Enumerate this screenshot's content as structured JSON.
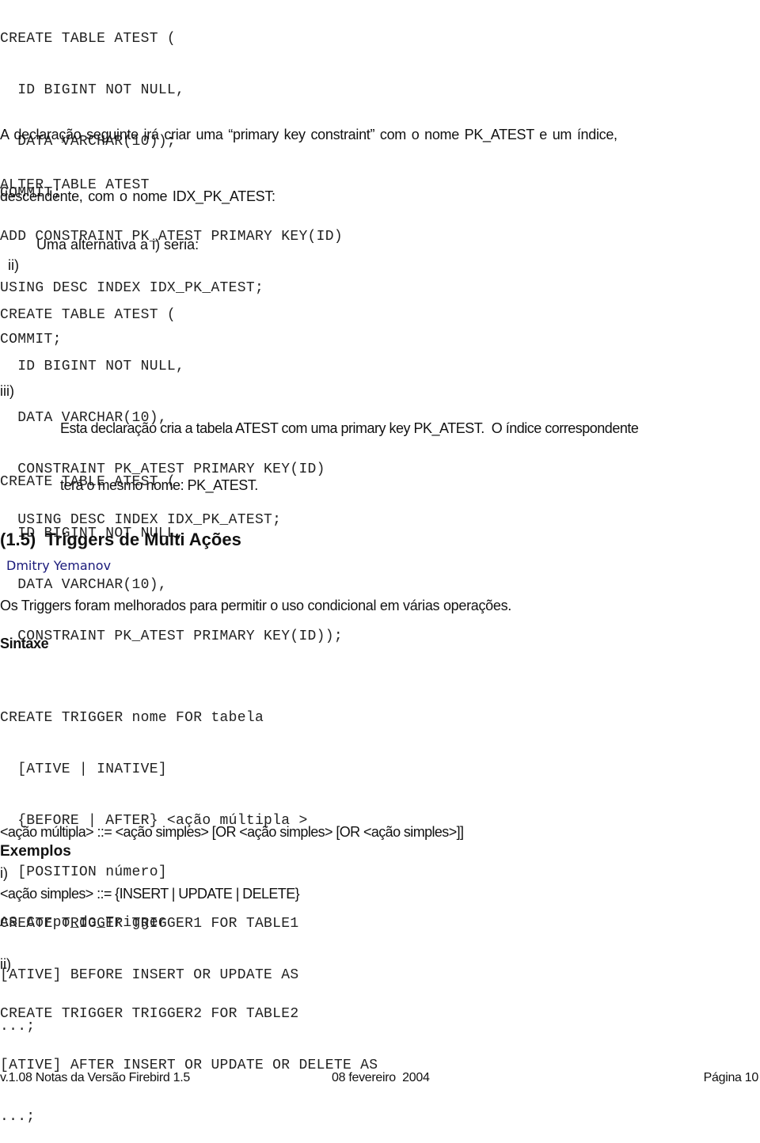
{
  "code_block_1": [
    "CREATE TABLE ATEST (",
    "  ID BIGINT NOT NULL,",
    "  DATA VARCHAR(10));",
    "COMMIT;"
  ],
  "paragraph_1": {
    "line1": "A declaração seguinte irá criar uma “primary key constraint” com o nome PK_ATEST e um índice,",
    "line2": "descendente, com o nome IDX_PK_ATEST:"
  },
  "code_block_2": [
    "ALTER TABLE ATEST",
    "ADD CONSTRAINT PK_ATEST PRIMARY KEY(ID)",
    "USING DESC INDEX IDX_PK_ATEST;",
    "COMMIT;"
  ],
  "item_ii": {
    "marker": "ii)",
    "text": "Uma alternativa a i) seria:"
  },
  "code_block_3": [
    "CREATE TABLE ATEST (",
    "  ID BIGINT NOT NULL,",
    "  DATA VARCHAR(10),",
    "  CONSTRAINT PK_ATEST PRIMARY KEY(ID)",
    "  USING DESC INDEX IDX_PK_ATEST;"
  ],
  "item_iii": {
    "marker": "iii)",
    "line1": "Esta declaração cria a tabela ATEST com uma primary key PK_ATEST.  O índice correspondente",
    "line2": "terá o mesmo nome: PK_ATEST."
  },
  "code_block_4": [
    "CREATE TABLE ATEST (",
    "  ID BIGINT NOT NULL,",
    "  DATA VARCHAR(10),",
    "  CONSTRAINT PK_ATEST PRIMARY KEY(ID));"
  ],
  "section": {
    "title": "(1.5)  Triggers de Multi Ações",
    "author": "Dmitry Yemanov",
    "intro": "Os Triggers foram melhorados para permitir o uso condicional em várias operações.",
    "syntax_heading": "Sintaxe",
    "syntax_code": [
      "CREATE TRIGGER nome FOR tabela",
      "  [ATIVE | INATIVE]",
      "  {BEFORE | AFTER} <ação múltipla >",
      "  [POSITION número]",
      "AS Corpo_do_Trigger"
    ],
    "grammar": [
      "<ação múltipla> ::= <ação simples> [OR <ação simples> [OR <ação simples>]]",
      "<ação simples> ::= {INSERT | UPDATE | DELETE}"
    ],
    "examples_heading": "Exemplos",
    "example_1": {
      "marker": "i)",
      "code": [
        "CREATE TRIGGER TRIGGER1 FOR TABLE1",
        "[ATIVE] BEFORE INSERT OR UPDATE AS",
        "...;"
      ]
    },
    "example_2": {
      "marker": "ii)",
      "code": [
        "CREATE TRIGGER TRIGGER2 FOR TABLE2",
        "[ATIVE] AFTER INSERT OR UPDATE OR DELETE AS",
        "...;"
      ]
    }
  },
  "footer": {
    "left": "v.1.08 Notas da Versão Firebird 1.5",
    "center": "08 fevereiro  2004",
    "right": "Página 10"
  }
}
